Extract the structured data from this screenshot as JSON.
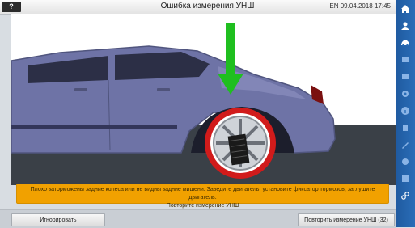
{
  "header": {
    "help_label": "?",
    "title": "Ошибка измерения УНШ",
    "status": "EN 09.04.2018 17:45"
  },
  "sidebar": {
    "items": [
      {
        "icon": "home-icon"
      },
      {
        "icon": "user-icon"
      },
      {
        "icon": "car-icon"
      },
      {
        "icon": "monitor-icon"
      },
      {
        "icon": "chart-icon"
      },
      {
        "icon": "settings-icon"
      },
      {
        "icon": "info-icon"
      },
      {
        "icon": "list-icon"
      },
      {
        "icon": "tools-icon"
      },
      {
        "icon": "camera-icon"
      },
      {
        "icon": "table-icon"
      },
      {
        "icon": "link-icon"
      }
    ]
  },
  "message": {
    "line1": "Плохо заторможены задние колеса или не видны задние мишени. Заведите двигатель, установите фиксатор тормозов, заглушите двигатель.",
    "line2": "Повторите измерение УНШ"
  },
  "footer": {
    "ignore_label": "Игнорировать",
    "repeat_label": "Повторить измерение УНШ (32)"
  },
  "colors": {
    "arrow": "#1fbf1f",
    "target_ring": "#e02020",
    "message_bg": "#f1a100",
    "sidebar": "#2a6db7"
  }
}
